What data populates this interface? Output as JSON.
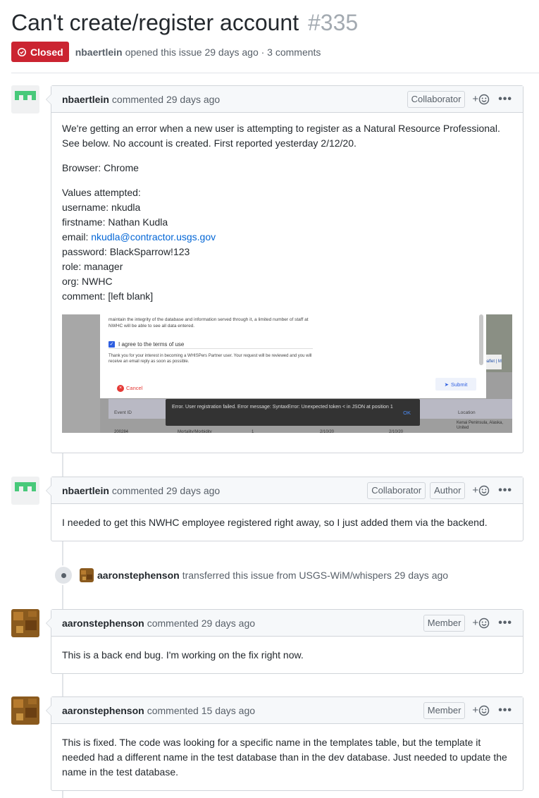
{
  "issue": {
    "title": "Can't create/register account",
    "number": "#335",
    "status": "Closed",
    "author": "nbaertlein",
    "meta": "opened this issue 29 days ago · 3 comments"
  },
  "comments": [
    {
      "author": "nbaertlein",
      "time": "commented 29 days ago",
      "roles": [
        "Collaborator"
      ],
      "body": {
        "p1_line1": "We're getting an error when a new user is attempting to register as a Natural Resource Professional.",
        "p1_line2": "See below. No account is created. First reported yesterday 2/12/20.",
        "p2": "Browser: Chrome",
        "values_heading": "Values attempted:",
        "username": "username: nkudla",
        "firstname": "firstname: Nathan Kudla",
        "email_label": "email: ",
        "email_link": "nkudla@contractor.usgs.gov",
        "password": "password: BlackSparrow!123",
        "role": "role: manager",
        "org": "org: NWHC",
        "comment": "comment: [left blank]"
      },
      "screenshot": {
        "dialog_text": "maintain the integrity of the database and information served through it, a limited number of staff at NWHC will be able to see all data entered.",
        "checkbox_label": "I agree to the terms of use",
        "thanks_text": "Thank you for your interest in becoming a WHISPers Partner user. Your request will be reviewed and you will receive an email reply as soon as possible.",
        "cancel": "Cancel",
        "submit": "Submit",
        "col_event_id": "Event ID",
        "col_location": "Location",
        "row_id": "200284",
        "row_type": "Mortality/Morbidity",
        "row_count": "1",
        "row_start": "2/10/20",
        "row_end": "2/10/20",
        "row_location": "Kenai Peninsula, Alaska, United",
        "toast_text": "Error. User registration failed. Error message: SyntaxError: Unexpected token < in JSON at position 1",
        "toast_ok": "OK",
        "leaflet": "Leaflet | M"
      }
    },
    {
      "author": "nbaertlein",
      "time": "commented 29 days ago",
      "roles": [
        "Collaborator",
        "Author"
      ],
      "body": "I needed to get this NWHC employee registered right away, so I just added them via the backend."
    },
    {
      "author": "aaronstephenson",
      "time": "commented 29 days ago",
      "roles": [
        "Member"
      ],
      "body": "This is a back end bug. I'm working on the fix right now."
    },
    {
      "author": "aaronstephenson",
      "time": "commented 15 days ago",
      "roles": [
        "Member"
      ],
      "body_line1": "This is fixed. The code was looking for a specific name in the templates table, but the template it",
      "body_line2": "needed had a different name in the test database than in the dev database. Just needed to update the",
      "body_line3": "name in the test database."
    }
  ],
  "event": {
    "actor": "aaronstephenson",
    "text": "transferred this issue from USGS-WiM/whispers 29 days ago"
  },
  "icons": {
    "closed": "issue-closed-icon",
    "reaction": "smiley-icon",
    "menu": "kebab-icon"
  },
  "colors": {
    "closed_badge": "#cb2431",
    "link": "#0366d6",
    "header_bg": "#f6f8fa",
    "border": "#d1d5da"
  }
}
